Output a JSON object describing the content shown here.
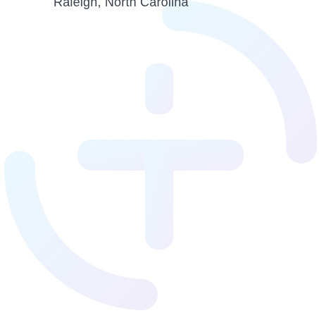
{
  "location": {
    "text": "Raleigh, North Carolina"
  },
  "watermark": {
    "icon": "medical-cross-logo-icon",
    "colors": {
      "gradient_start": "#eaf7fd",
      "gradient_end": "#f1eefb"
    }
  }
}
